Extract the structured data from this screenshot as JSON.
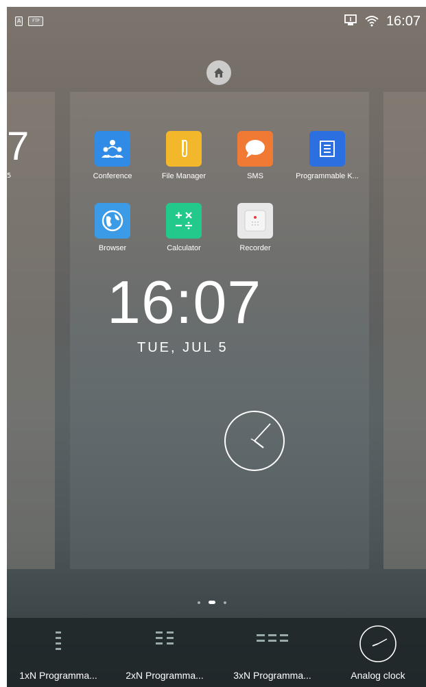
{
  "status": {
    "badge_a": "A",
    "badge_ftp": "FTP",
    "time": "16:07"
  },
  "edge": {
    "clock_fragment": "7",
    "date_fragment": "5"
  },
  "apps": [
    {
      "label": "Conference",
      "icon": "conference-icon",
      "color": "#2f8be6"
    },
    {
      "label": "File Manager",
      "icon": "file-manager-icon",
      "color": "#f2b72a"
    },
    {
      "label": "SMS",
      "icon": "sms-icon",
      "color": "#f07a34"
    },
    {
      "label": "Programmable K...",
      "icon": "programmable-keys-icon",
      "color": "#2b6fe0"
    },
    {
      "label": "Browser",
      "icon": "browser-icon",
      "color": "#3b9be6"
    },
    {
      "label": "Calculator",
      "icon": "calculator-icon",
      "color": "#22c98a"
    },
    {
      "label": "Recorder",
      "icon": "recorder-icon",
      "color": "#e8e8e8"
    }
  ],
  "clock": {
    "time": "16:07",
    "date": "TUE, JUL 5"
  },
  "widgets": [
    {
      "label": "1xN Programma..."
    },
    {
      "label": "2xN Programma..."
    },
    {
      "label": "3xN Programma..."
    },
    {
      "label": "Analog clock"
    }
  ]
}
